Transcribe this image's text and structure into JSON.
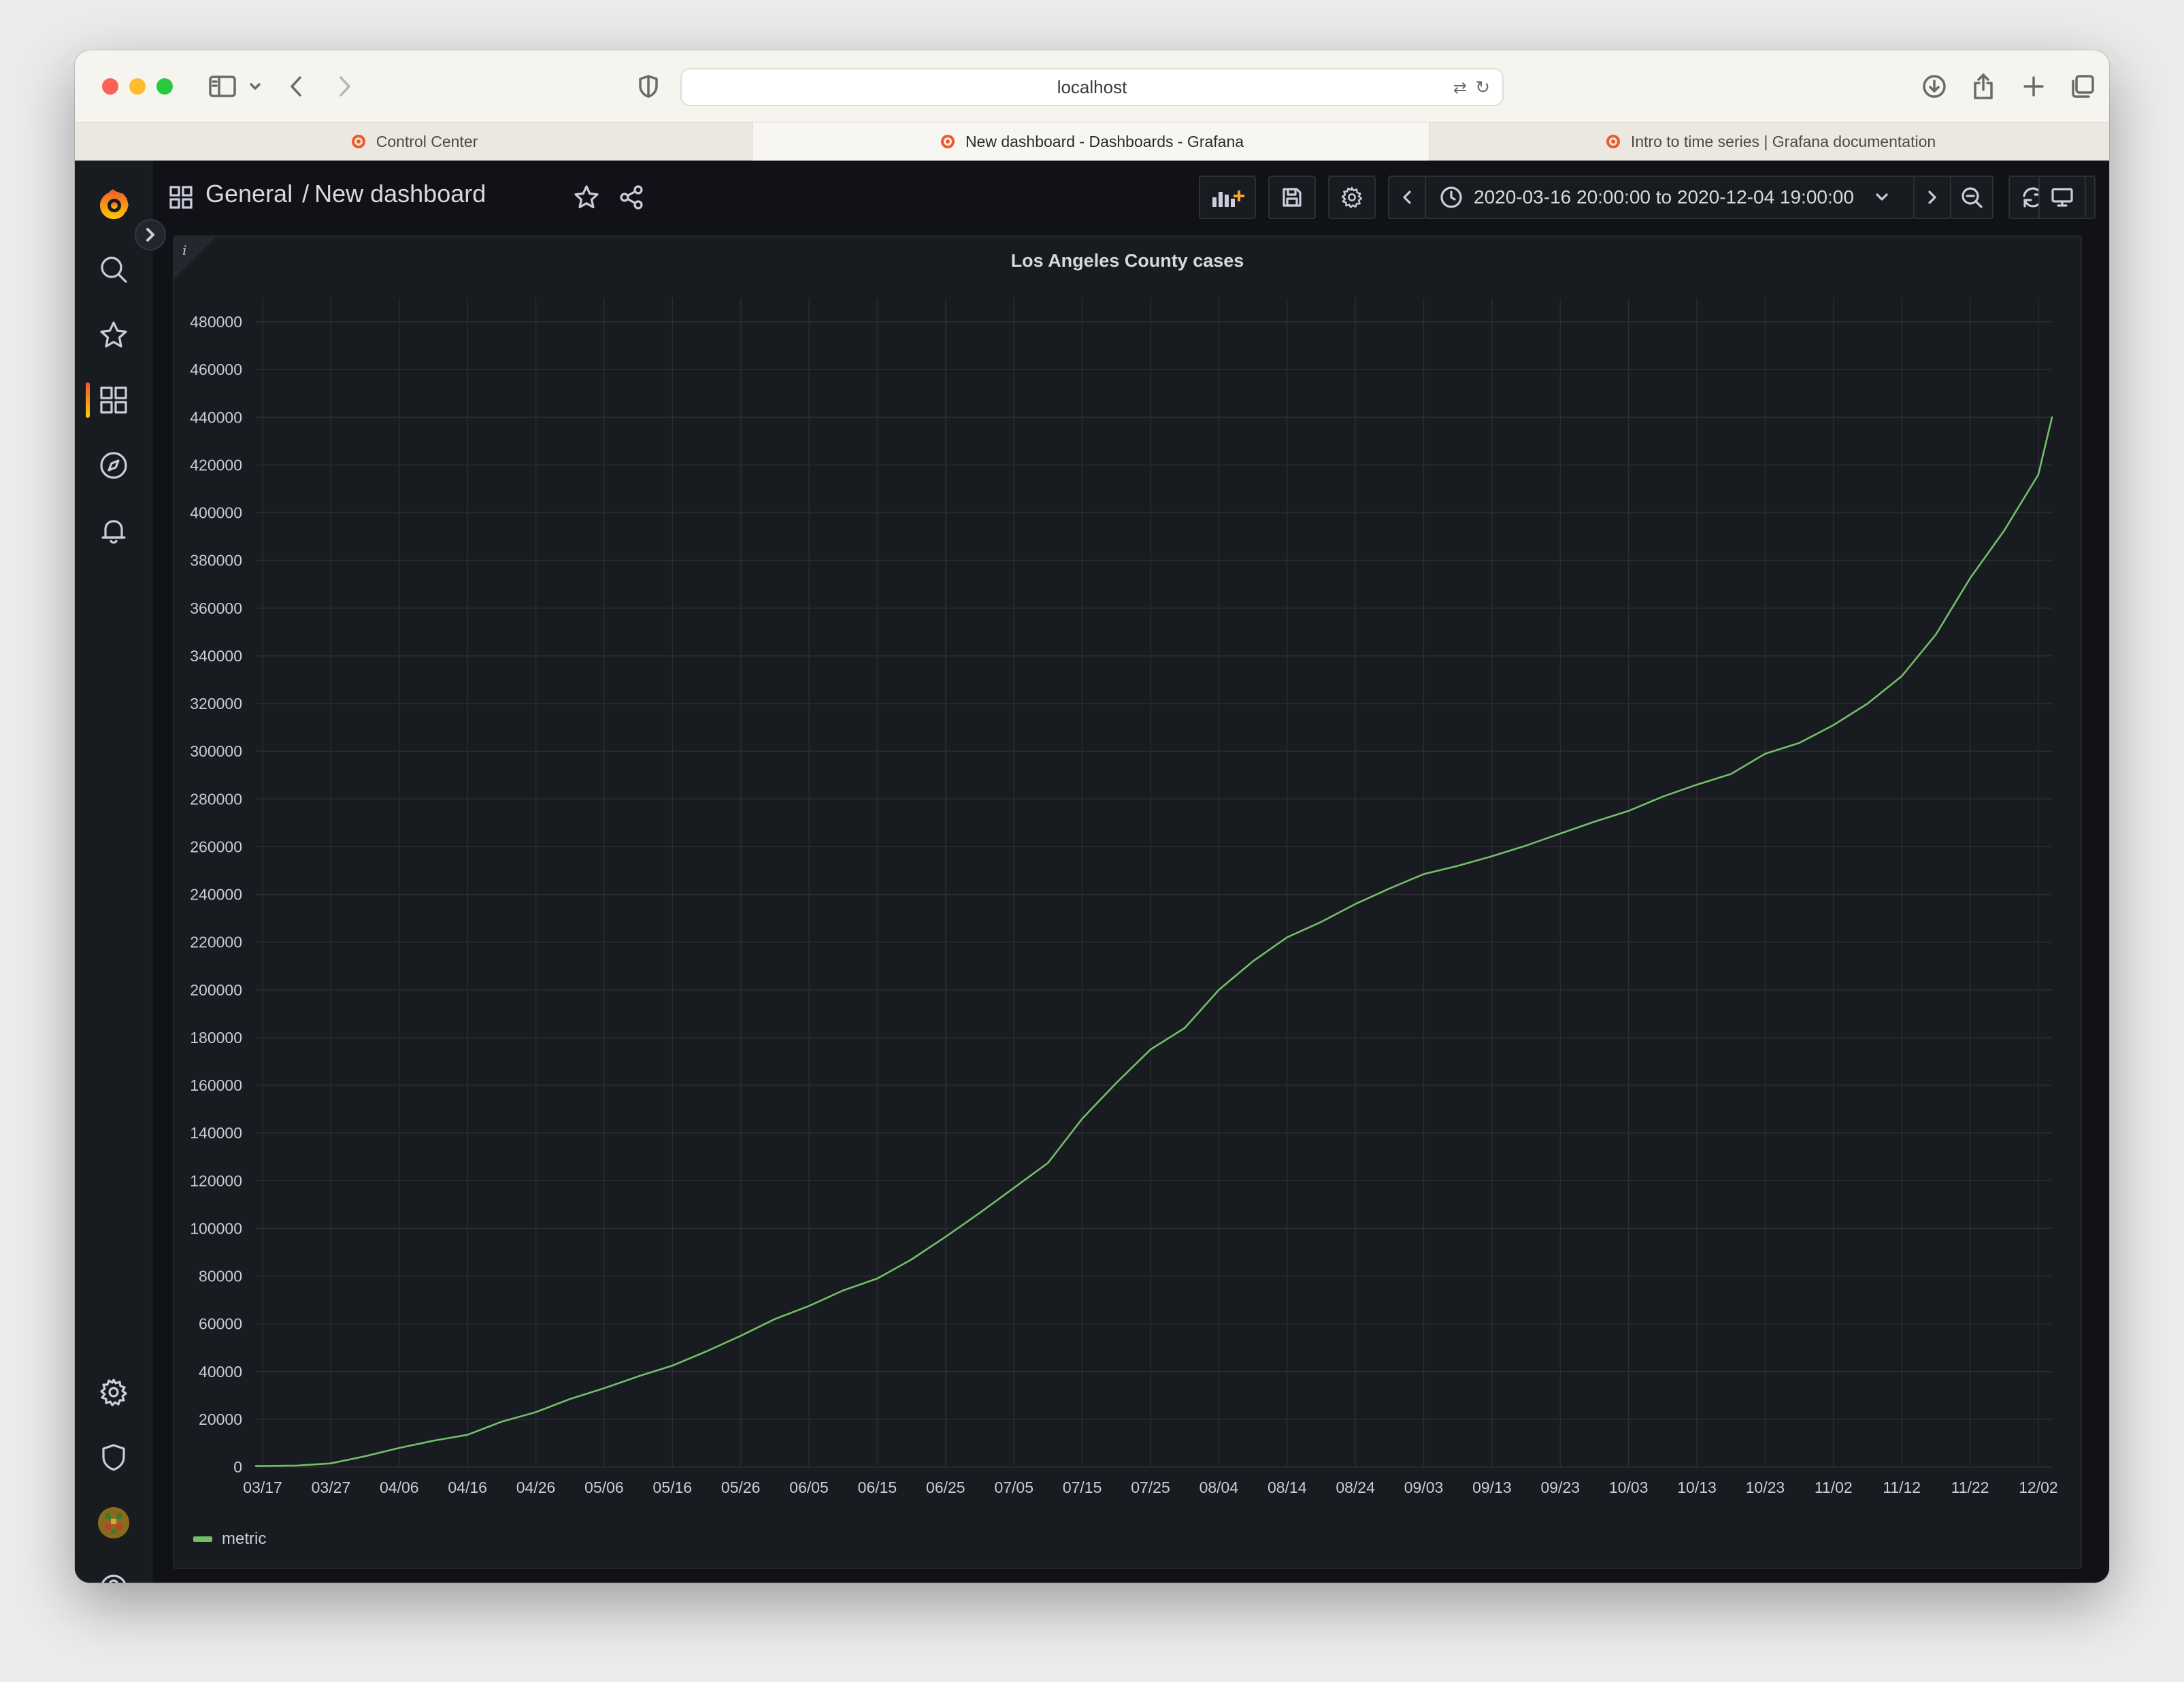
{
  "browser": {
    "address": "localhost",
    "tabs": [
      {
        "label": "Control Center"
      },
      {
        "label": "New dashboard - Dashboards - Grafana"
      },
      {
        "label": "Intro to time series | Grafana documentation"
      }
    ]
  },
  "dashboard": {
    "folder": "General",
    "separator": "/",
    "title": "New dashboard",
    "time_range": "2020-03-16 20:00:00 to 2020-12-04 19:00:00"
  },
  "panel": {
    "title": "Los Angeles County cases",
    "info_icon": "i",
    "legend": [
      {
        "name": "metric",
        "color": "#73bf69"
      }
    ]
  },
  "colors": {
    "accent": "#f05a28",
    "series": "#73bf69",
    "background": "#181b1f"
  },
  "chart_data": {
    "type": "line",
    "title": "Los Angeles County cases",
    "xlabel": "",
    "ylabel": "",
    "x_tick_labels": [
      "03/17",
      "03/27",
      "04/06",
      "04/16",
      "04/26",
      "05/06",
      "05/16",
      "05/26",
      "06/05",
      "06/15",
      "06/25",
      "07/05",
      "07/15",
      "07/25",
      "08/04",
      "08/14",
      "08/24",
      "09/03",
      "09/13",
      "09/23",
      "10/03",
      "10/13",
      "10/23",
      "11/02",
      "11/12",
      "11/22",
      "12/02"
    ],
    "y_ticks": [
      0,
      20000,
      40000,
      60000,
      80000,
      100000,
      120000,
      140000,
      160000,
      180000,
      200000,
      220000,
      240000,
      260000,
      280000,
      300000,
      320000,
      340000,
      360000,
      380000,
      400000,
      420000,
      440000,
      460000,
      480000
    ],
    "ylim": [
      0,
      490000
    ],
    "xlim": [
      "2020-03-16",
      "2020-12-04"
    ],
    "grid": true,
    "legend_position": "bottom-left",
    "series": [
      {
        "name": "metric",
        "color": "#73bf69",
        "x": [
          "2020-03-16",
          "2020-03-22",
          "2020-03-27",
          "2020-04-01",
          "2020-04-06",
          "2020-04-11",
          "2020-04-16",
          "2020-04-21",
          "2020-04-26",
          "2020-05-01",
          "2020-05-06",
          "2020-05-11",
          "2020-05-16",
          "2020-05-21",
          "2020-05-26",
          "2020-05-31",
          "2020-06-05",
          "2020-06-10",
          "2020-06-15",
          "2020-06-20",
          "2020-06-25",
          "2020-06-30",
          "2020-07-05",
          "2020-07-10",
          "2020-07-15",
          "2020-07-20",
          "2020-07-25",
          "2020-07-30",
          "2020-08-04",
          "2020-08-09",
          "2020-08-14",
          "2020-08-19",
          "2020-08-24",
          "2020-08-29",
          "2020-09-03",
          "2020-09-08",
          "2020-09-13",
          "2020-09-18",
          "2020-09-23",
          "2020-09-28",
          "2020-10-03",
          "2020-10-08",
          "2020-10-13",
          "2020-10-18",
          "2020-10-23",
          "2020-10-28",
          "2020-11-02",
          "2020-11-07",
          "2020-11-12",
          "2020-11-17",
          "2020-11-22",
          "2020-11-27",
          "2020-12-02",
          "2020-12-04"
        ],
        "y": [
          400,
          600,
          1500,
          4500,
          8000,
          11000,
          13500,
          19000,
          23000,
          28500,
          33000,
          38000,
          42500,
          48500,
          55000,
          62000,
          67500,
          74000,
          79000,
          87000,
          96500,
          106500,
          117000,
          127500,
          146000,
          161000,
          175000,
          184000,
          200000,
          212000,
          222000,
          228500,
          236000,
          242500,
          248500,
          252000,
          256000,
          260500,
          265500,
          270500,
          275000,
          281000,
          286000,
          290500,
          299000,
          303500,
          311000,
          320000,
          331500,
          349000,
          372500,
          392500,
          416000,
          440000
        ]
      }
    ]
  }
}
